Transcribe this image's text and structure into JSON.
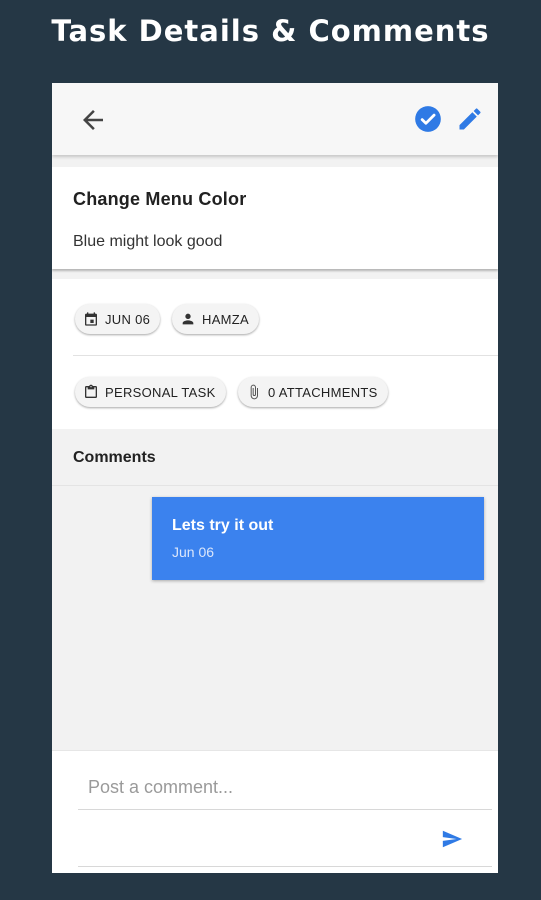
{
  "banner": {
    "title": "Task Details & Comments"
  },
  "colors": {
    "accent": "#3b82ee",
    "background": "#253745",
    "icon_blue": "#2f7ae5"
  },
  "appbar": {
    "back_icon": "arrow-back-icon",
    "check_icon": "check-circle-icon",
    "edit_icon": "pencil-icon"
  },
  "task": {
    "title": "Change Menu Color",
    "description": "Blue might look good"
  },
  "chips": {
    "date": {
      "label": "JUN 06",
      "icon": "calendar-icon"
    },
    "assignee": {
      "label": "HAMZA",
      "icon": "person-icon"
    },
    "category": {
      "label": "PERSONAL TASK",
      "icon": "clipboard-icon"
    },
    "attachments": {
      "label": "0 ATTACHMENTS",
      "icon": "paperclip-icon"
    }
  },
  "comments": {
    "header": "Comments",
    "items": [
      {
        "text": "Lets try it out",
        "date": "Jun 06"
      }
    ]
  },
  "composer": {
    "placeholder": "Post a comment...",
    "value": "",
    "send_icon": "send-icon"
  }
}
